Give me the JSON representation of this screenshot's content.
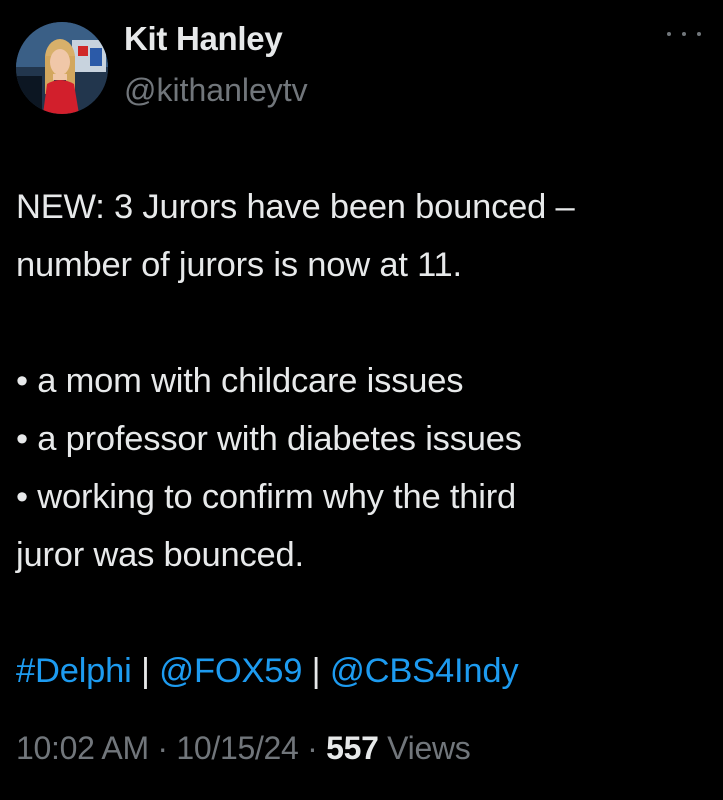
{
  "author": {
    "display_name": "Kit Hanley",
    "handle": "@kithanleytv"
  },
  "tweet": {
    "intro_line1": "NEW: 3 Jurors have been bounced –",
    "intro_line2": "number of jurors is now at 11.",
    "bullets": [
      "• a mom with childcare issues",
      "• a professor with diabetes issues",
      "• working to confirm why the third"
    ],
    "bullet_continuation": "juror was bounced.",
    "tags": {
      "hashtag": "#Delphi",
      "separator": " | ",
      "mention1": "@FOX59",
      "mention2": "@CBS4Indy"
    }
  },
  "meta": {
    "time": "10:02 AM",
    "dot": " · ",
    "date": "10/15/24",
    "views_count": "557",
    "views_label": " Views"
  },
  "colors": {
    "background": "#000000",
    "text": "#e7e9ea",
    "secondary": "#71767b",
    "link": "#1d9bf0"
  },
  "icons": {
    "more": "more-horizontal-icon"
  }
}
